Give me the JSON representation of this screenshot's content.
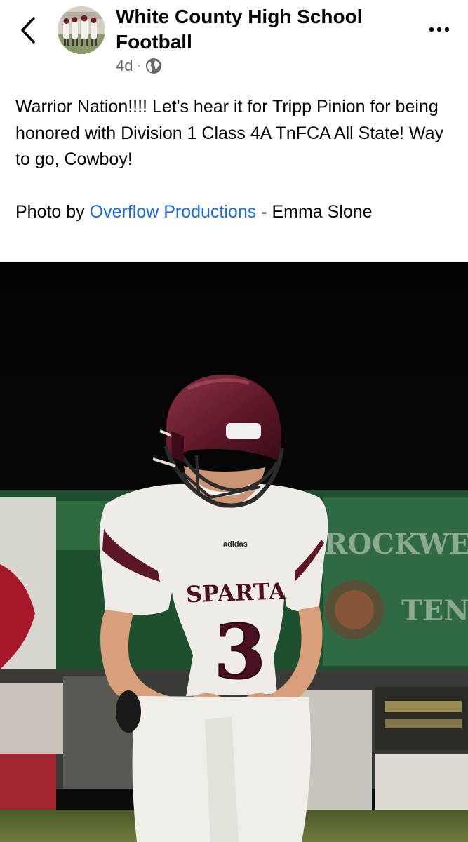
{
  "header": {
    "page_name": "White County High School Football",
    "time_ago": "4d",
    "separator": "·",
    "audience_icon": "globe-icon",
    "back_icon": "chevron-left-icon",
    "more_icon": "more-horizontal-icon"
  },
  "post": {
    "text": "Warrior Nation!!!! Let's hear it for Tripp Pinion for being honored with Division 1 Class 4A TnFCA All State!  Way to go, Cowboy!",
    "credit_prefix": "Photo by",
    "credit_link": "Overflow Productions",
    "credit_suffix": "- Emma Slone"
  },
  "photo": {
    "jersey_text": "SPARTA",
    "jersey_number": "3",
    "brand_text": "adidas",
    "banner_text_1": "ROCKWELL",
    "banner_text_2": "TEN"
  },
  "colors": {
    "link": "#1b6ad6",
    "meta": "#65676b",
    "maroon": "#6b1f2e"
  }
}
